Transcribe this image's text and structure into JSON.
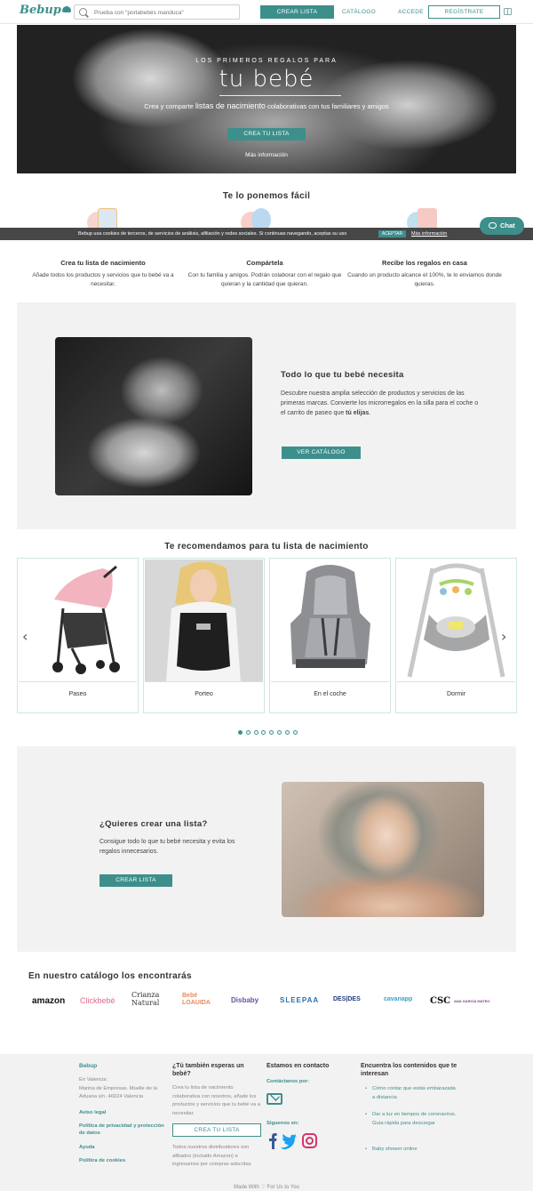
{
  "header": {
    "logo": "Bebup",
    "search_placeholder": "Prueba con \"portabebés manduca\"",
    "crear_lista": "CREAR LISTA",
    "catalogo": "CATÁLOGO",
    "accede": "ACCEDE",
    "registrate": "REGÍSTRATE"
  },
  "hero": {
    "kicker": "LOS PRIMEROS REGALOS PARA",
    "title": "tu bebé",
    "subtitle_pre": "Crea y comparte ",
    "subtitle_bold": "listas de nacimiento",
    "subtitle_post": " colaborativas con tus familiares y amigos",
    "button": "CREA TU LISTA",
    "more": "Más información"
  },
  "facil": {
    "heading": "Te lo ponemos fácil",
    "features": [
      {
        "title": "Crea tu lista de nacimiento",
        "text": "Añade todos los productos y servicios que tu bebé va a necesitar."
      },
      {
        "title": "Compártela",
        "text": "Con tu familia y amigos. Podrán colaborar con el regalo que quieran y la cantidad que quieran."
      },
      {
        "title": "Recibe los regalos en casa",
        "text": "Cuando un producto alcance el 100%, te lo enviamos donde quieras."
      }
    ]
  },
  "cookie": {
    "text": "Bebup usa cookies de terceros, de servicios de análisis, afiliación y redes sociales. Si continuas navegando, aceptas su uso",
    "accept": "ACEPTAR",
    "more": "Más información"
  },
  "chat": {
    "label": "Chat"
  },
  "necesita": {
    "heading": "Todo lo que tu bebé necesita",
    "text": "Descubre nuestra amplia selección de productos y servicios de las primeras marcas. Convierte los microrregalos en la silla para el coche o el carrito de paseo que",
    "text_bold": "tú elijas",
    "text_end": ".",
    "button": "VER CATÁLOGO"
  },
  "recomendamos": {
    "heading": "Te recomendamos para tu lista de nacimiento",
    "cards": [
      {
        "label": "Paseo"
      },
      {
        "label": "Porteo"
      },
      {
        "label": "En el coche"
      },
      {
        "label": "Dormir"
      }
    ],
    "dots_total": 8,
    "dots_active": 0
  },
  "crear": {
    "heading": "¿Quieres crear una lista?",
    "text": "Consigue todo lo que tu bebé necesita y evita los regalos innecesarios.",
    "button": "CREAR LISTA"
  },
  "catalogo": {
    "heading": "En nuestro catálogo los encontrarás",
    "brands": [
      "amazon",
      "Clickbebé",
      "Crianza Natural",
      "Bebé LOAUIDA",
      "Disbaby",
      "SLEEPAA",
      "DES|DES",
      "cavanapp",
      "CSC",
      "ANA GARCÍA MATEO"
    ]
  },
  "footer": {
    "col1_title": "Bebup",
    "address": "En Valencia:\nMarina de Empresas. Muelle de la Aduana s/n. 46024 Valencia",
    "links": [
      "Aviso legal",
      "Política de privacidad y protección de datos",
      "Ayuda",
      "Política de cookies"
    ],
    "col2_title": "¿Tú también esperas un bebé?",
    "col2_text": "Crea tu lista de nacimiento colaborativa con nosotros, añade los productos y servicios que tu bebé va a necesitar.",
    "col2_button": "CREA TU LISTA",
    "col2_note": "Todos nuestros distribuidores son afiliados (incluido Amazon) e ingresamos por compras adscritas",
    "col3_title": "Estamos en contacto",
    "col3_contact": "Contáctanos por:",
    "col3_follow": "Síguenos en:",
    "col4_title": "Encuentra los contenidos que te interesan",
    "col4_items": [
      "Cómo contar que estás embarazada a distancia",
      "Dar a luz en tiempos de coronavirus. Guía rápida para descargar",
      "Baby shower online"
    ],
    "made_with": "Made With",
    "made_for": "For Us to You"
  }
}
